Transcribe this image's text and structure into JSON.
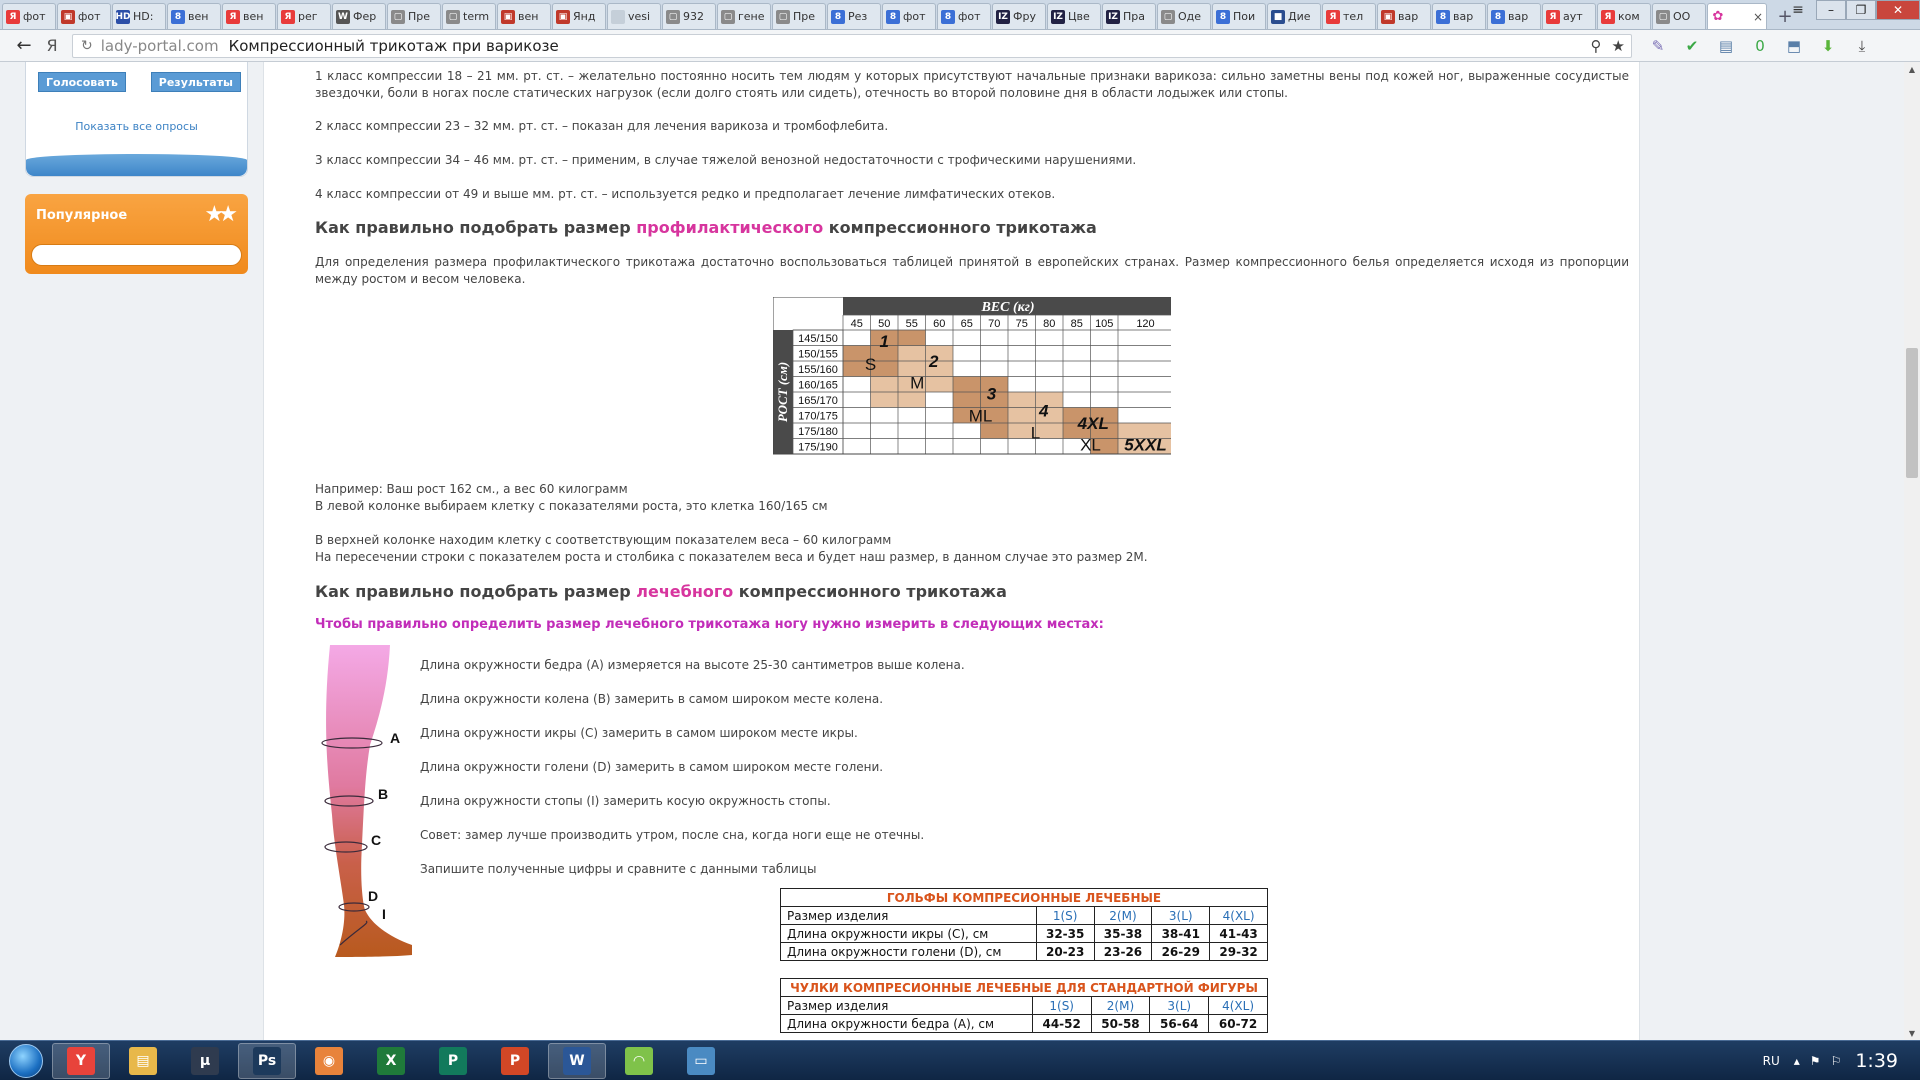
{
  "browser": {
    "tabs": [
      {
        "fav": "Я",
        "color": "#e83b3b",
        "label": "фот"
      },
      {
        "fav": "▣",
        "color": "#c0392b",
        "label": "фот"
      },
      {
        "fav": "HD",
        "color": "#2c4fa8",
        "label": "HD:"
      },
      {
        "fav": "8",
        "color": "#3b6fd6",
        "label": "вен"
      },
      {
        "fav": "Я",
        "color": "#e83b3b",
        "label": "вен"
      },
      {
        "fav": "Я",
        "color": "#e83b3b",
        "label": "рег"
      },
      {
        "fav": "W",
        "color": "#555555",
        "label": "Фер"
      },
      {
        "fav": "▢",
        "color": "#8a8a8a",
        "label": "Пре"
      },
      {
        "fav": "▢",
        "color": "#8a8a8a",
        "label": "term"
      },
      {
        "fav": "▣",
        "color": "#c0392b",
        "label": "вен"
      },
      {
        "fav": "▣",
        "color": "#c0392b",
        "label": "Янд"
      },
      {
        "fav": "",
        "color": "#c5cfd9",
        "label": "vesi"
      },
      {
        "fav": "▢",
        "color": "#8a8a8a",
        "label": "932"
      },
      {
        "fav": "▢",
        "color": "#8a8a8a",
        "label": "гене"
      },
      {
        "fav": "▢",
        "color": "#8a8a8a",
        "label": "Пре"
      },
      {
        "fav": "8",
        "color": "#3b6fd6",
        "label": "Рез"
      },
      {
        "fav": "8",
        "color": "#3b6fd6",
        "label": "фот"
      },
      {
        "fav": "8",
        "color": "#3b6fd6",
        "label": "фот"
      },
      {
        "fav": "IZ",
        "color": "#222244",
        "label": "Фру"
      },
      {
        "fav": "IZ",
        "color": "#222244",
        "label": "Цве"
      },
      {
        "fav": "IZ",
        "color": "#222244",
        "label": "Пра"
      },
      {
        "fav": "▢",
        "color": "#8a8a8a",
        "label": "Оде"
      },
      {
        "fav": "8",
        "color": "#3b6fd6",
        "label": "Пои"
      },
      {
        "fav": "■",
        "color": "#2a4d8f",
        "label": "Дие"
      },
      {
        "fav": "Я",
        "color": "#e83b3b",
        "label": "тел"
      },
      {
        "fav": "▣",
        "color": "#c0392b",
        "label": "вар"
      },
      {
        "fav": "8",
        "color": "#3b6fd6",
        "label": "вар"
      },
      {
        "fav": "8",
        "color": "#3b6fd6",
        "label": "вар"
      },
      {
        "fav": "Я",
        "color": "#e83b3b",
        "label": "аут"
      },
      {
        "fav": "Я",
        "color": "#e83b3b",
        "label": "ком"
      },
      {
        "fav": "▢",
        "color": "#8a8a8a",
        "label": "ОО"
      }
    ],
    "active_tab": {
      "fav": "✿",
      "color": "#d7359e",
      "close": "×"
    },
    "new_tab": "+",
    "menu_icon": "≡",
    "window_controls": {
      "minimize": "–",
      "maximize": "❐",
      "close": "✕"
    },
    "back_icon": "←",
    "yandex_icon": "Я",
    "reload_icon": "↻",
    "domain": "lady-portal.com",
    "title": "Компрессионный трикотаж при варикозе",
    "url_icons": {
      "protect": "⚲",
      "bookmark": "★"
    },
    "extensions": [
      {
        "glyph": "✎",
        "color": "#7a6fb5"
      },
      {
        "glyph": "✔",
        "color": "#3aa845"
      },
      {
        "glyph": "▤",
        "color": "#5a7fa8"
      },
      {
        "glyph": "0",
        "color": "#3aa845"
      },
      {
        "glyph": "⬒",
        "color": "#5a7fa8"
      },
      {
        "glyph": "⬇",
        "color": "#59b53a"
      },
      {
        "glyph": "⤓",
        "color": "#444444"
      }
    ]
  },
  "sidebar": {
    "vote_button": "Голосовать",
    "results_button": "Результаты",
    "all_polls": "Показать все опросы",
    "popular_title": "Популярное",
    "popular_stars": "★★"
  },
  "article": {
    "class1": "1 класс компрессии 18 – 21 мм. рт. ст. – желательно постоянно носить тем людям у которых присутствуют начальные признаки варикоза: сильно заметны вены под кожей ног, выраженные сосудистые звездочки, боли в ногах после статических нагрузок (если долго стоять или сидеть), отечность во второй половине дня в области лодыжек или стопы.",
    "class2": "2 класс компрессии 23 – 32 мм. рт. ст. – показан для лечения варикоза и тромбофлебита.",
    "class3": "3 класс компрессии 34 – 46 мм. рт. ст. – применим, в случае тяжелой венозной недостаточности с трофическими нарушениями.",
    "class4": "4 класс компрессии от 49 и выше мм. рт. ст. – используется редко и предполагает лечение лимфатических отеков.",
    "h_prof_a": "Как правильно подобрать размер ",
    "h_prof_pink": "профилактического",
    "h_prof_b": " компрессионного трикотажа",
    "prof_text": "Для определения размера профилактического трикотажа достаточно воспользоваться таблицей принятой в европейских странах. Размер компрессионного белья определяется исходя из пропорции между ростом и весом человека.",
    "example1": "Например: Ваш рост 162 см., а вес 60 килограмм",
    "example2": "В левой колонке выбираем клетку с показателями роста, это клетка 160/165 см",
    "example3": "В верхней колонке находим клетку с соответствующим показателем веса – 60 килограмм",
    "example4": "На пересечении строки с показателем роста и столбика с показателем веса и будет наш размер, в данном случае это размер 2M.",
    "h_med_a": "Как правильно подобрать размер ",
    "h_med_pink": "лечебного",
    "h_med_b": " компрессионного трикотажа",
    "measure_intro": "Чтобы правильно определить размер лечебного трикотажа ногу нужно измерить в следующих местах:",
    "measures": [
      "Длина окружности бедра (А) измеряется на высоте 25-30 сантиметров выше колена.",
      "Длина окружности колена (B) замерить в самом широком месте колена.",
      "Длина окружности икры (C) замерить в самом широком месте икры.",
      "Длина окружности голени (D) замерить в самом широком месте голени.",
      "Длина окружности стопы (I) замерить косую окружность стопы.",
      "Совет: замер лучше производить утром, после сна, когда ноги еще не отечны.",
      "Запишите полученные цифры и сравните с данными таблицы"
    ],
    "leg_labels": {
      "a": "A",
      "b": "B",
      "c": "C",
      "d": "D",
      "i": "I"
    }
  },
  "size_chart": {
    "weight_title": "ВЕС (кг)",
    "height_title": "РОСТ (см)",
    "weights": [
      "45",
      "50",
      "55",
      "60",
      "65",
      "70",
      "75",
      "80",
      "85",
      "105",
      "120"
    ],
    "heights": [
      "145/150",
      "150/155",
      "155/160",
      "160/165",
      "165/170",
      "170/175",
      "175/180",
      "175/190"
    ],
    "zones": [
      {
        "num": "1",
        "size": "S",
        "color": "#c9946a"
      },
      {
        "num": "2",
        "size": "M",
        "color": "#e6c2a2"
      },
      {
        "num": "3",
        "size": "ML",
        "color": "#c9946a"
      },
      {
        "num": "4",
        "size": "L",
        "color": "#e6c2a2"
      },
      {
        "num": "4XL",
        "size": "XL",
        "color": "#c9946a"
      },
      {
        "num": "5XXL",
        "size": "XXL",
        "color": "#e6c2a2"
      }
    ]
  },
  "tables": {
    "golf": {
      "title": "ГОЛЬФЫ КОМПРЕСИОННЫЕ ЛЕЧЕБНЫЕ",
      "header": [
        "Размер изделия",
        "1(S)",
        "2(M)",
        "3(L)",
        "4(XL)"
      ],
      "rows": [
        [
          "Длина окружности икры (C), см",
          "32-35",
          "35-38",
          "38-41",
          "41-43"
        ],
        [
          "Длина окружности голени (D), см",
          "20-23",
          "23-26",
          "26-29",
          "29-32"
        ]
      ]
    },
    "stockings": {
      "title": "ЧУЛКИ КОМПРЕСИОННЫЕ ЛЕЧЕБНЫЕ ДЛЯ СТАНДАРТНОЙ ФИГУРЫ",
      "header": [
        "Размер изделия",
        "1(S)",
        "2(M)",
        "3(L)",
        "4(XL)"
      ],
      "rows": [
        [
          "Длина окружности бедра (А), см",
          "44-52",
          "50-58",
          "56-64",
          "60-72"
        ]
      ]
    }
  },
  "taskbar": {
    "apps": [
      {
        "name": "yandex-browser",
        "glyph": "Y",
        "color": "#e8433b",
        "active": true
      },
      {
        "name": "explorer",
        "glyph": "▤",
        "color": "#e8b84a",
        "active": false
      },
      {
        "name": "bittorrent",
        "glyph": "μ",
        "color": "#2f3b4f",
        "active": false
      },
      {
        "name": "photoshop",
        "glyph": "Ps",
        "color": "#1d3a5c",
        "active": true
      },
      {
        "name": "eye-app",
        "glyph": "◉",
        "color": "#e8833b",
        "active": false
      },
      {
        "name": "excel",
        "glyph": "X",
        "color": "#1f7a3a",
        "active": false
      },
      {
        "name": "publisher",
        "glyph": "P",
        "color": "#127a5c",
        "active": false
      },
      {
        "name": "powerpoint",
        "glyph": "P",
        "color": "#d24726",
        "active": false
      },
      {
        "name": "word",
        "glyph": "W",
        "color": "#2b5797",
        "active": true
      },
      {
        "name": "wifi-app",
        "glyph": "◠",
        "color": "#7fc24a",
        "active": false
      },
      {
        "name": "screen-app",
        "glyph": "▭",
        "color": "#4a8ac2",
        "active": false
      }
    ],
    "lang": "RU",
    "tray_icons": [
      "▴",
      "⚑",
      "⚐"
    ],
    "clock": "1:39"
  }
}
